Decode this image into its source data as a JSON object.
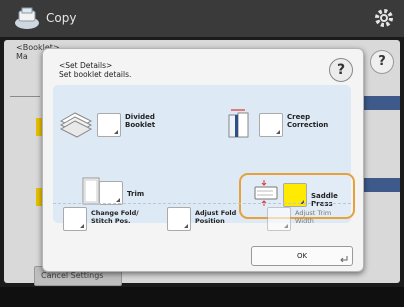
{
  "app": {
    "title": "Copy"
  },
  "background": {
    "label_top": "<Booklet>",
    "label_bottom": "Ma",
    "help_glyph": "?",
    "bottom_button": "Cancel Settings"
  },
  "dialog": {
    "header_line1": "<Set Details>",
    "header_line2": "Set booklet details.",
    "help_glyph": "?",
    "options": [
      {
        "label": "Divided\nBooklet",
        "icon": "divided-booklet-icon"
      },
      {
        "label": "Creep\nCorrection",
        "icon": "creep-correction-icon"
      },
      {
        "label": "Trim",
        "icon": "trim-icon"
      },
      {
        "label": "Saddle Press",
        "icon": "saddle-press-icon",
        "selected": true
      }
    ],
    "bottom_options": [
      {
        "label": "Change Fold/\nStitch Pos.",
        "icon": "change-fold-icon",
        "enabled": true
      },
      {
        "label": "Adjust Fold\nPosition",
        "icon": "adjust-fold-icon",
        "enabled": true
      },
      {
        "label": "Adjust Trim\nWidth",
        "icon": "adjust-trim-icon",
        "enabled": false
      }
    ],
    "ok_label": "OK"
  },
  "colors": {
    "selection_ring": "#e6a13a",
    "panel": "#dde9f5",
    "active_toggle": "#ffeb00"
  }
}
